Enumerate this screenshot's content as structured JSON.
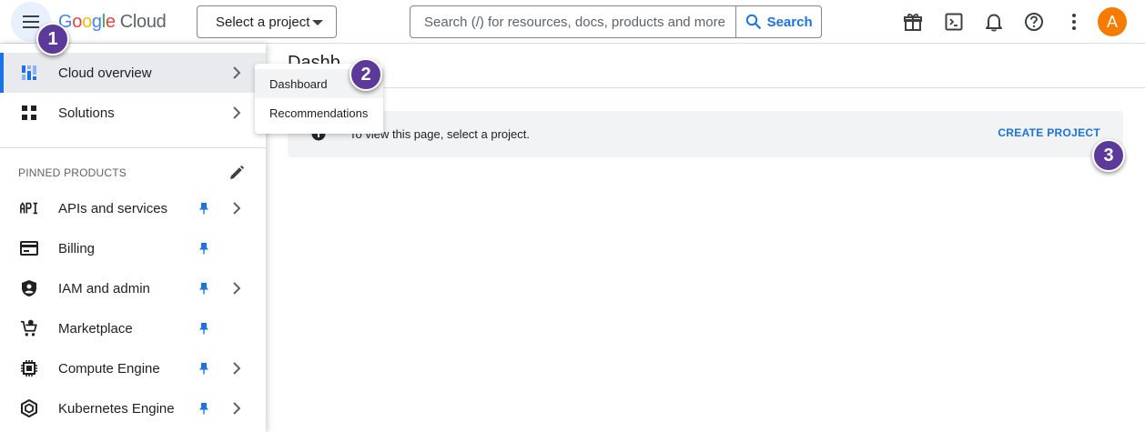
{
  "header": {
    "logo_google": "Google",
    "logo_cloud": "Cloud",
    "project_select_label": "Select a project",
    "search_placeholder": "Search (/) for resources, docs, products and more",
    "search_button_label": "Search",
    "avatar_initial": "A"
  },
  "sidebar": {
    "top_items": [
      {
        "label": "Cloud overview",
        "icon": "dashboard-icon",
        "active": true,
        "has_submenu": true
      },
      {
        "label": "Solutions",
        "icon": "grid-icon",
        "active": false,
        "has_submenu": true
      }
    ],
    "pinned_section_title": "PINNED PRODUCTS",
    "pinned_items": [
      {
        "label": "APIs and services",
        "icon": "api-icon",
        "has_submenu": true
      },
      {
        "label": "Billing",
        "icon": "billing-icon",
        "has_submenu": false
      },
      {
        "label": "IAM and admin",
        "icon": "shield-icon",
        "has_submenu": true
      },
      {
        "label": "Marketplace",
        "icon": "cart-icon",
        "has_submenu": false
      },
      {
        "label": "Compute Engine",
        "icon": "chip-icon",
        "has_submenu": true
      },
      {
        "label": "Kubernetes Engine",
        "icon": "hexagon-icon",
        "has_submenu": true
      }
    ]
  },
  "flyout": {
    "items": [
      "Dashboard",
      "Recommendations"
    ]
  },
  "main": {
    "title": "Dashb",
    "banner_message": "To view this page, select a project.",
    "create_project_label": "CREATE PROJECT"
  },
  "step_badges": [
    "1",
    "2",
    "3"
  ],
  "colors": {
    "accent_blue": "#1a73e8",
    "badge_purple": "#5b3a99",
    "avatar_orange": "#f57c00",
    "pin_blue": "#1a73e8"
  }
}
